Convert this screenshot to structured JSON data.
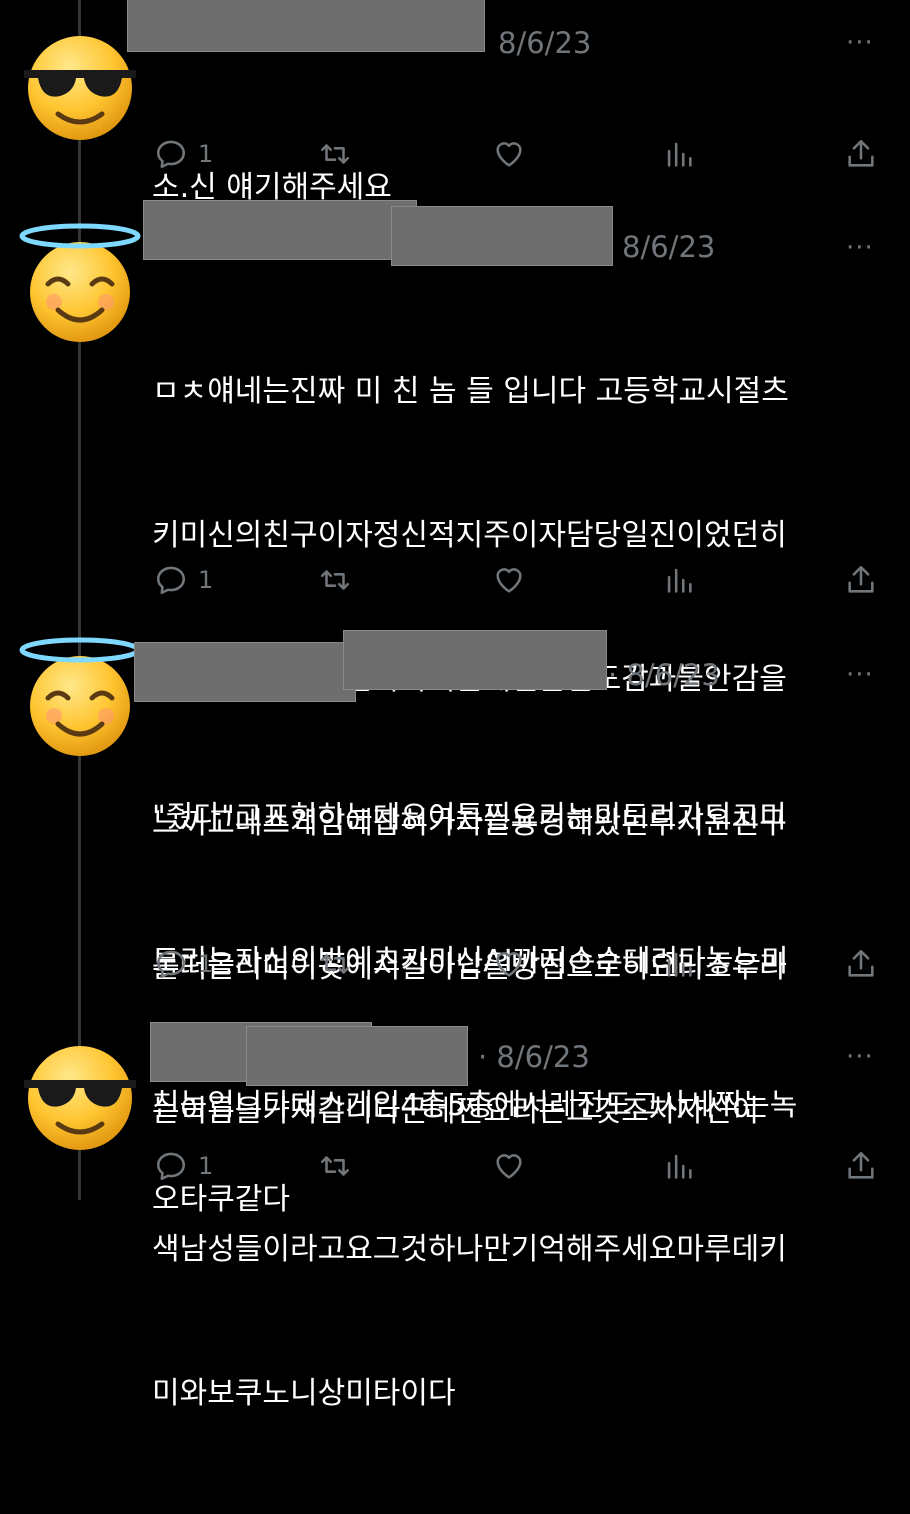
{
  "colors": {
    "background": "#000000",
    "text": "#ffffff",
    "muted": "#71767b",
    "thread_line": "#333639",
    "redaction": "#6e6e6e"
  },
  "replies": [
    {
      "avatar": "sunglasses-emoji",
      "date": "8/6/23",
      "text_lines": [
        "소.신 얘기해주세요"
      ],
      "reply_count": "1"
    },
    {
      "avatar": "halo-emoji",
      "date": "8/6/23",
      "text_lines": [
        "ㅁㅊ얘네는진짜 미 친 놈 들 입니다 고등학교시절츠",
        "키미신의친구이자정신적지주이자담당일진이었던히",
        "요리소우가어느날사라지는데신은안도감과불안감을",
        "느끼고데스게임에잡혀가자늘동경해왔던무서운친구",
        "를떠올리며이곳에서살아남을방법으로히요리소우라",
        "는이름을가져갑니다근데찐요리는그것조차자신이"
      ],
      "reply_count": "1"
    },
    {
      "avatar": "halo-emoji",
      "date": "· 8/6/23",
      "text_lines": [
        "\"줬다\"고표현하는데요여튼찐요리는미도리가되고미",
        "도리는자신의방에츠키미신AI까지손수데려다놓는미",
        "친놈입니다데스게임4층5층에서레전드그사세찍는녹",
        "색남성들이라고요그것하나만기억해주세요마루데키",
        "미와보쿠노니상미타이다"
      ],
      "reply_count": "1"
    },
    {
      "avatar": "sunglasses-emoji",
      "date": "· 8/6/23",
      "text_lines": [
        "오타쿠같다"
      ],
      "reply_count": "1"
    }
  ],
  "icons": {
    "reply": "reply-icon",
    "retweet": "retweet-icon",
    "like": "heart-icon",
    "views": "views-icon",
    "share": "share-icon",
    "more": "more-icon"
  },
  "more_glyph": "···"
}
